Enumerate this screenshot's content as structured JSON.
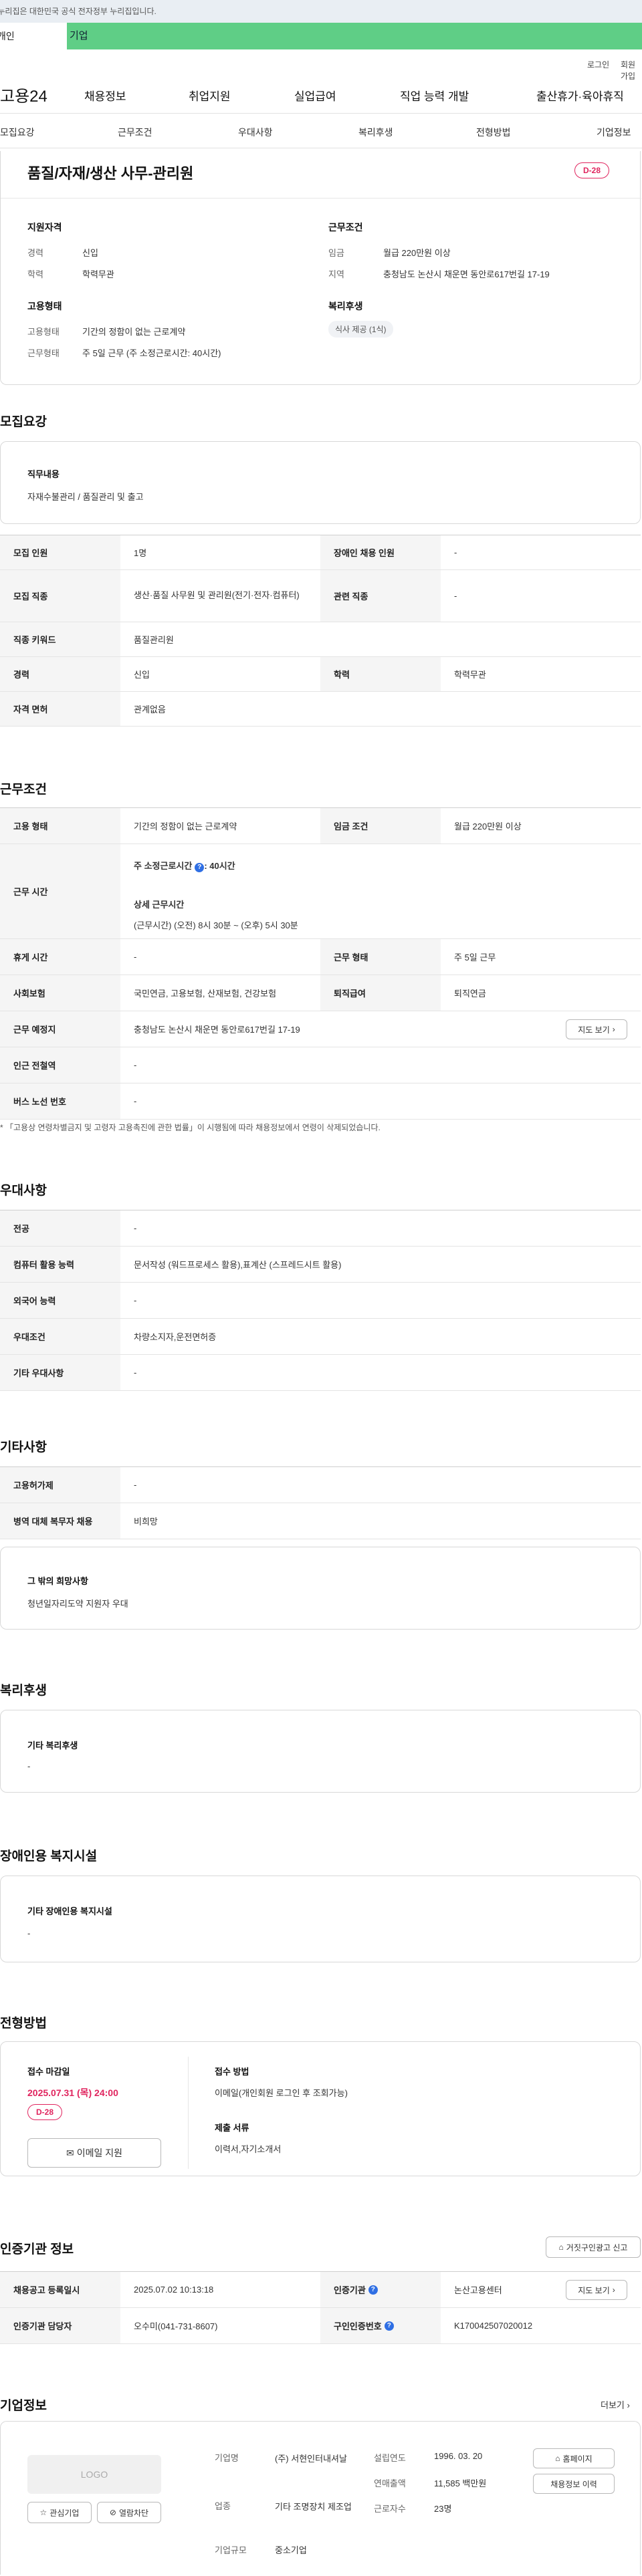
{
  "banner": {
    "text": "이 누리집은 대한민국 공식 전자정부 누리집입니다."
  },
  "gnb_tabs": {
    "personal": "개인",
    "company": "기업"
  },
  "util": {
    "login": "로그인",
    "join": "회원가입"
  },
  "header": {
    "logo": "고용24",
    "menu": [
      "채용정보",
      "취업지원",
      "실업급여",
      "직업 능력 개발",
      "출산휴가·육아휴직"
    ]
  },
  "tabs": [
    "모집요강",
    "근무조건",
    "우대사항",
    "복리후생",
    "전형방법",
    "기업정보"
  ],
  "job": {
    "title": "품질/자재/생산 사무-관리원",
    "dday": "D-28",
    "qual_heading": "지원자격",
    "career_label": "경력",
    "career": "신입",
    "edu_label": "학력",
    "edu": "학력무관",
    "cond_heading": "근무조건",
    "wage_label": "임금",
    "wage": "월급 220만원 이상",
    "region_label": "지역",
    "region": "충청남도 논산시 채운면 동안로617번길 17-19",
    "emp_heading": "고용형태",
    "emp_label": "고용형태",
    "emp": "기간의 정함이 없는 근로계약",
    "form_label": "근무형태",
    "form": "주 5일 근무 (주 소정근로시간: 40시간)",
    "welfare_heading": "복리후생",
    "welfare_tag": "식사 제공 (1식)"
  },
  "recruit": {
    "heading": "모집요강",
    "duty_title": "직무내용",
    "duty": "자재수불관리 / 품질관리 및 출고",
    "rows": {
      "count_label": "모집 인원",
      "count": "1명",
      "disabled_label": "장애인 채용 인원",
      "disabled": "-",
      "job_label": "모집 직종",
      "job": "생산·품질 사무원 및 관리원(전기·전자·컴퓨터)",
      "related_label": "관련 직종",
      "related": "-",
      "keyword_label": "직종 키워드",
      "keyword": "품질관리원",
      "career_label": "경력",
      "career": "신입",
      "edu_label": "학력",
      "edu": "학력무관",
      "license_label": "자격 면허",
      "license": "관계없음"
    }
  },
  "work": {
    "heading": "근무조건",
    "emp_label": "고용 형태",
    "emp": "기간의 정함이 없는 근로계약",
    "wage_label": "임금 조건",
    "wage": "월급 220만원 이상",
    "time_label": "근무 시간",
    "time_week": "주 소정근로시간",
    "time_week_val": ": 40시간",
    "time_detail_title": "상세 근무시간",
    "time_detail": "(근무시간) (오전) 8시 30분 ~ (오후) 5시 30분",
    "break_label": "휴게 시간",
    "break": "-",
    "form_label": "근무 형태",
    "form": "주 5일 근무",
    "insur_label": "사회보험",
    "insur": "국민연금, 고용보험, 산재보험, 건강보험",
    "retire_label": "퇴직급여",
    "retire": "퇴직연금",
    "place_label": "근무 예정지",
    "place": "충청남도 논산시 채운면 동안로617번길 17-19",
    "map_btn": "지도 보기",
    "subway_label": "인근 전철역",
    "subway": "-",
    "bus_label": "버스 노선 번호",
    "bus": "-",
    "note": "* 「고용상 연령차별금지 및 고령자 고용촉진에 관한 법률」이 시행됨에 따라 채용정보에서 연령이 삭제되었습니다."
  },
  "pref": {
    "heading": "우대사항",
    "major_label": "전공",
    "major": "-",
    "pc_label": "컴퓨터 활용 능력",
    "pc": "문서작성 (워드프로세스 활용),표계산 (스프레드시트 활용)",
    "lang_label": "외국어 능력",
    "lang": "-",
    "cond_label": "우대조건",
    "cond": "차량소지자,운전면허증",
    "etc_label": "기타 우대사항",
    "etc": "-"
  },
  "other": {
    "heading": "기타사항",
    "visa_label": "고용허가제",
    "visa": "-",
    "mil_label": "병역 대체 복무자 채용",
    "mil": "비희망",
    "extra_title": "그 밖의 희망사항",
    "extra": "청년일자리도약 지원자 우대"
  },
  "welfare": {
    "heading": "복리후생",
    "title": "기타 복리후생",
    "value": "-"
  },
  "facility": {
    "heading": "장애인용 복지시설",
    "title": "기타 장애인용 복지시설",
    "value": "-"
  },
  "selection": {
    "heading": "전형방법",
    "deadline_label": "접수 마감일",
    "deadline": "2025.07.31 (목) 24:00",
    "dday": "D-28",
    "apply_btn": "이메일 지원",
    "method_label": "접수 방법",
    "method": "이메일(개인회원 로그인 후 조회가능)",
    "docs_label": "제출 서류",
    "docs": "이력서,자기소개서"
  },
  "cert": {
    "heading": "인증기관 정보",
    "report_btn": "거짓구인광고 신고",
    "date_label": "채용공고 등록일시",
    "date": "2025.07.02 10:13:18",
    "org_label": "인증기관",
    "org": "논산고용센터",
    "map_btn": "지도 보기",
    "staff_label": "인증기관 담당자",
    "staff": "오수미(041-731-8607)",
    "no_label": "구인인증번호",
    "no": "K170042507020012"
  },
  "company": {
    "heading": "기업정보",
    "more": "더보기",
    "logo": "LOGO",
    "fav_btn": "관심기업",
    "block_btn": "열람차단",
    "name_label": "기업명",
    "name": "(주) 서현인터내셔날",
    "industry_label": "업종",
    "industry": "기타 조명장치 제조업",
    "size_label": "기업규모",
    "size": "중소기업",
    "found_label": "설립연도",
    "found": "1996. 03. 20",
    "sales_label": "연매출액",
    "sales": "11,585 백만원",
    "staff_label": "근로자수",
    "staff": "23명",
    "home_btn": "홈페이지",
    "jobs_btn": "채용정보 이력"
  }
}
